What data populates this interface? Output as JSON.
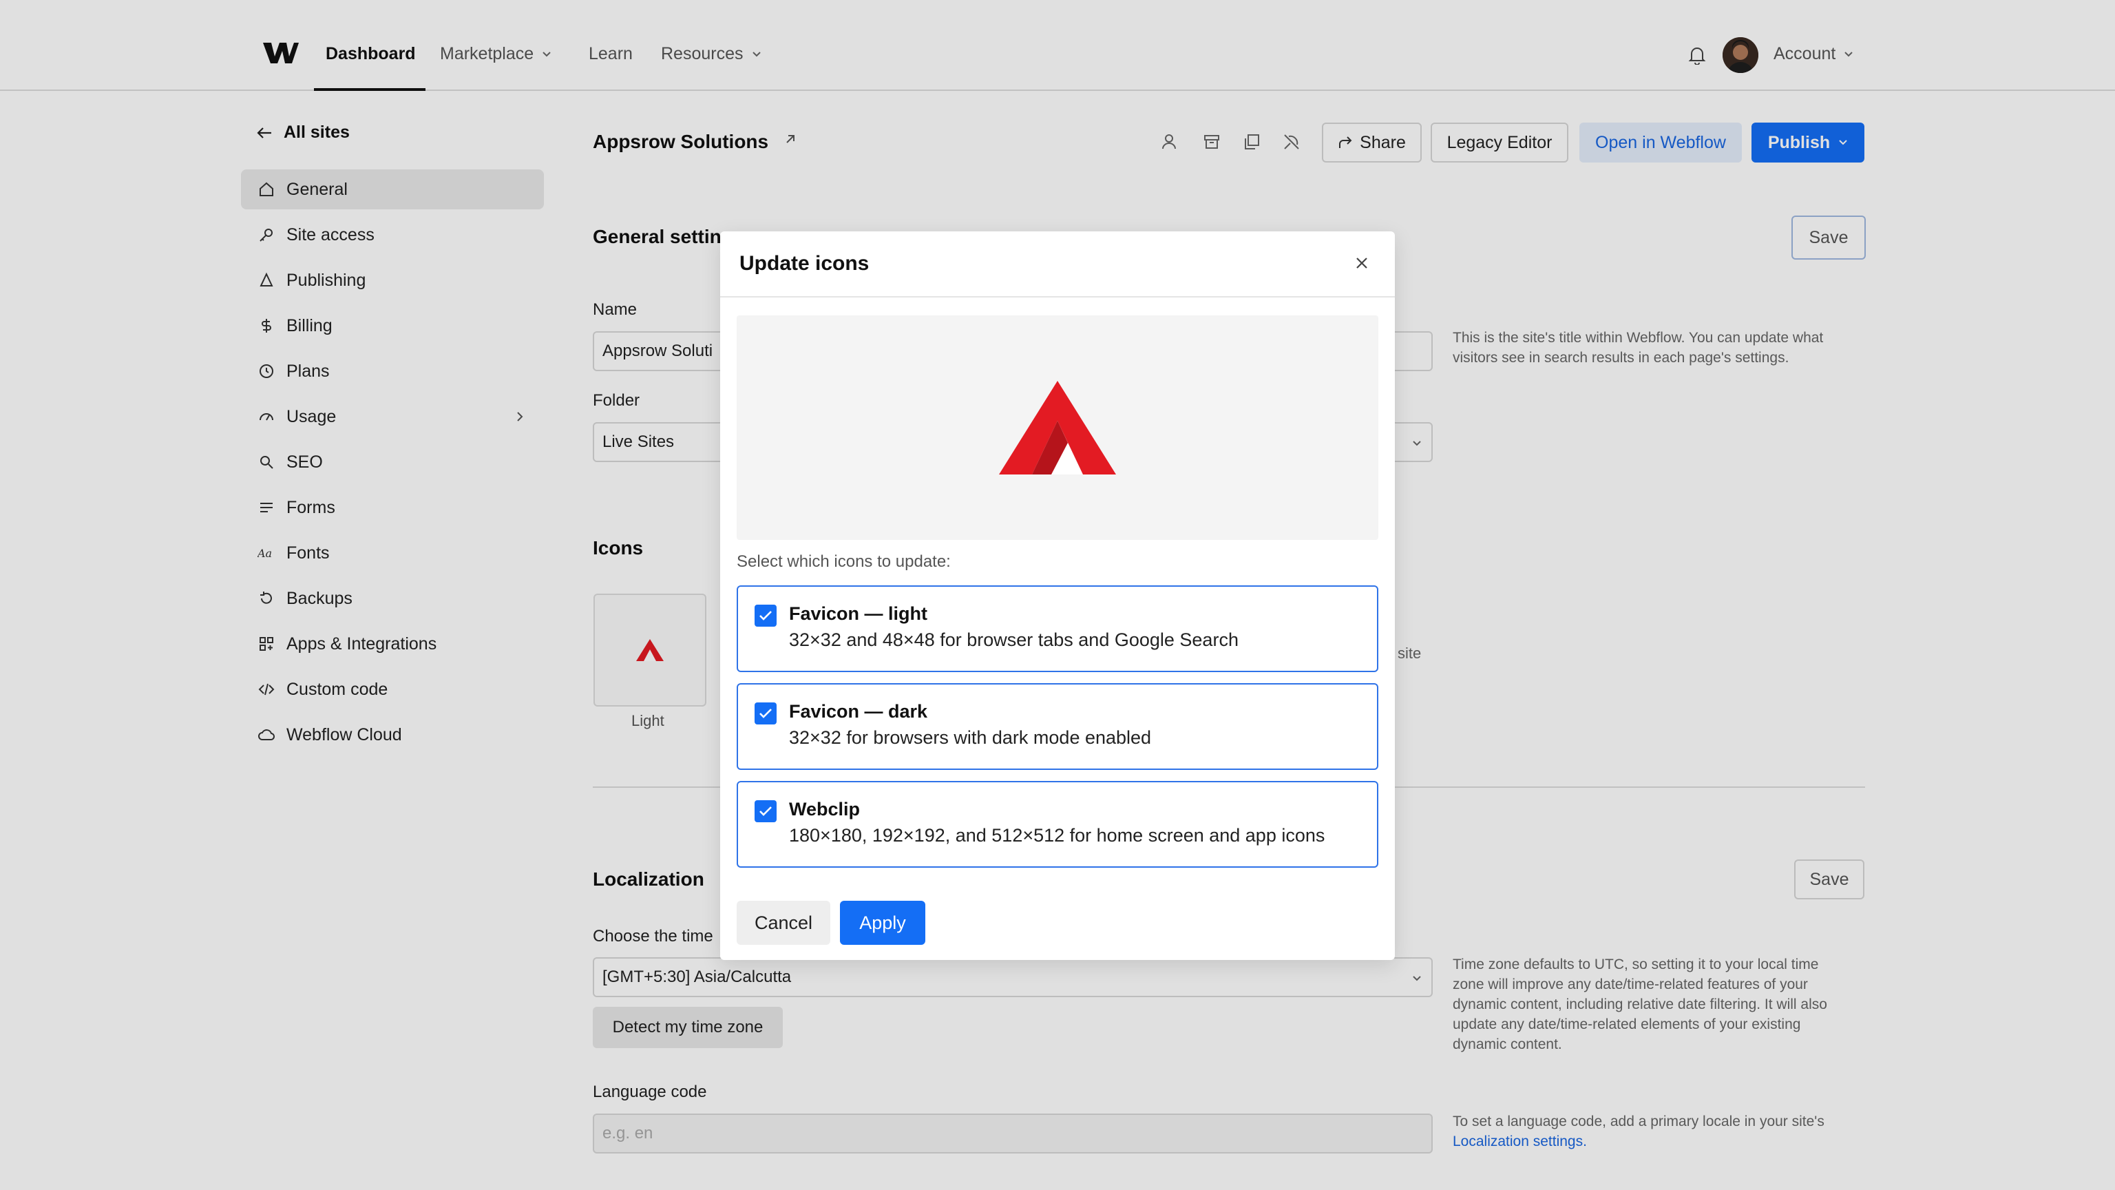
{
  "nav": {
    "dashboard": "Dashboard",
    "marketplace": "Marketplace",
    "learn": "Learn",
    "resources": "Resources",
    "account": "Account"
  },
  "sidebar": {
    "back": "All sites",
    "items": [
      {
        "label": "General",
        "icon": "home-icon"
      },
      {
        "label": "Site access",
        "icon": "key-icon"
      },
      {
        "label": "Publishing",
        "icon": "publish-icon"
      },
      {
        "label": "Billing",
        "icon": "dollar-icon"
      },
      {
        "label": "Plans",
        "icon": "plans-icon"
      },
      {
        "label": "Usage",
        "icon": "gauge-icon"
      },
      {
        "label": "SEO",
        "icon": "search-icon"
      },
      {
        "label": "Forms",
        "icon": "forms-icon"
      },
      {
        "label": "Fonts",
        "icon": "fonts-icon"
      },
      {
        "label": "Backups",
        "icon": "backup-icon"
      },
      {
        "label": "Apps & Integrations",
        "icon": "apps-icon"
      },
      {
        "label": "Custom code",
        "icon": "code-icon"
      },
      {
        "label": "Webflow Cloud",
        "icon": "cloud-icon"
      }
    ]
  },
  "header": {
    "site_name": "Appsrow Solutions",
    "share": "Share",
    "legacy_editor": "Legacy Editor",
    "open_in_webflow": "Open in Webflow",
    "publish": "Publish"
  },
  "general": {
    "title": "General settin",
    "save": "Save",
    "name_label": "Name",
    "name_value": "Appsrow Soluti",
    "name_help": "This is the site's title within Webflow. You can update what visitors see in search results in each page's settings.",
    "folder_label": "Folder",
    "folder_value": "Live Sites"
  },
  "icons": {
    "title": "Icons",
    "light_caption": "Light",
    "side_text": "site"
  },
  "localization": {
    "title": "Localization",
    "save": "Save",
    "tz_label": "Choose the time",
    "tz_value": "[GMT+5:30] Asia/Calcutta",
    "tz_help": "Time zone defaults to UTC, so setting it to your local time zone will improve any date/time-related features of your dynamic content, including relative date filtering. It will also update any date/time-related elements of your existing dynamic content.",
    "detect": "Detect my time zone",
    "lang_label": "Language code",
    "lang_placeholder": "e.g. en",
    "lang_help": "To set a language code, add a primary locale in your site's",
    "lang_link": "Localization settings."
  },
  "modal": {
    "title": "Update icons",
    "select_text": "Select which icons to update:",
    "options": [
      {
        "title": "Favicon — light",
        "desc": "32×32 and 48×48 for browser tabs and Google Search",
        "checked": true
      },
      {
        "title": "Favicon — dark",
        "desc": "32×32 for browsers with dark mode enabled",
        "checked": true
      },
      {
        "title": "Webclip",
        "desc": "180×180, 192×192, and 512×512 for home screen and app icons",
        "checked": true
      }
    ],
    "cancel": "Cancel",
    "apply": "Apply"
  },
  "colors": {
    "primary": "#146ef5",
    "logo_red": "#e31b23"
  }
}
